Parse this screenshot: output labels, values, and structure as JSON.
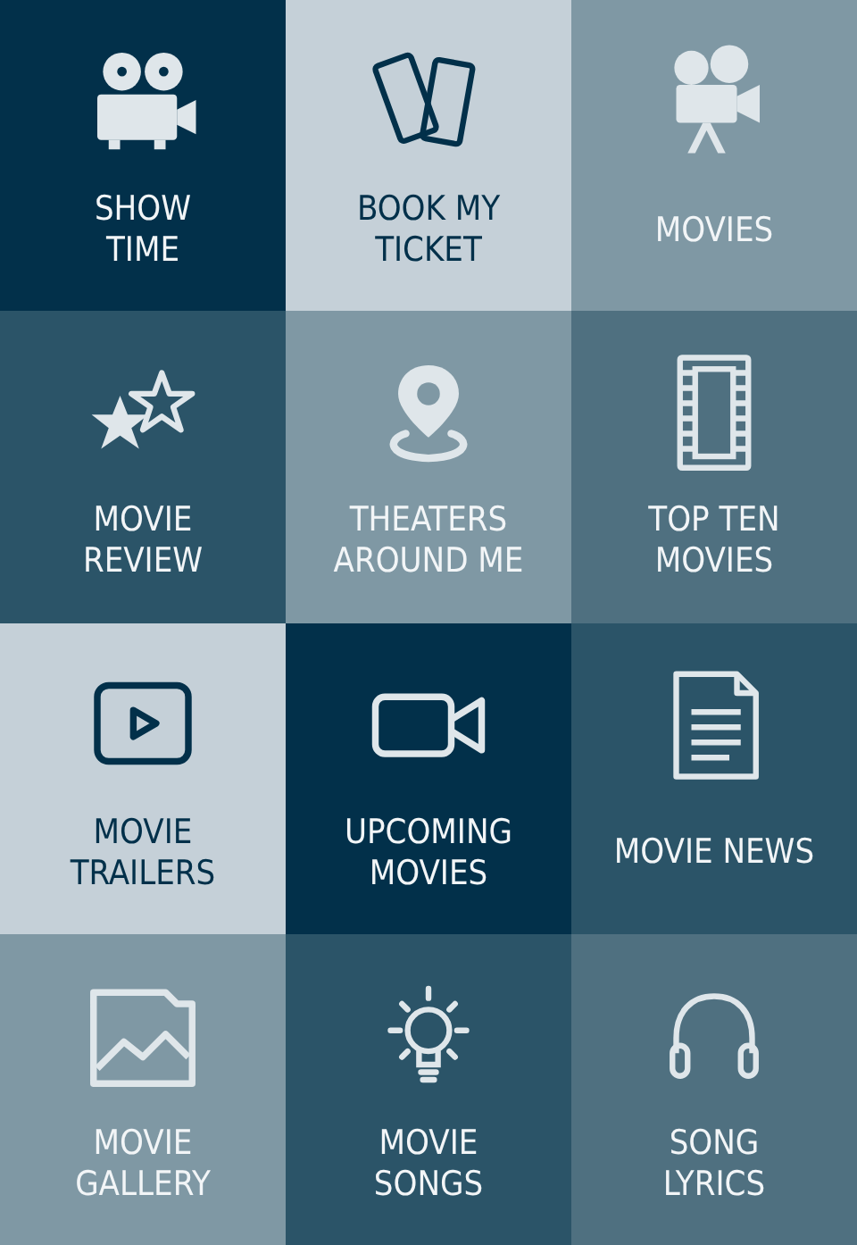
{
  "tiles": [
    {
      "lines": [
        "SHOW",
        "TIME"
      ],
      "color": "#02304a"
    },
    {
      "lines": [
        "BOOK MY",
        "TICKET"
      ],
      "color": "#c5d0d8"
    },
    {
      "lines": [
        "MOVIES"
      ],
      "color": "#7f98a4"
    },
    {
      "lines": [
        "MOVIE",
        "REVIEW"
      ],
      "color": "#2b5468"
    },
    {
      "lines": [
        "THEATERS",
        "AROUND ME"
      ],
      "color": "#7f98a4"
    },
    {
      "lines": [
        "TOP TEN",
        "MOVIES"
      ],
      "color": "#4f7080"
    },
    {
      "lines": [
        "MOVIE",
        "TRAILERS"
      ],
      "color": "#c5d0d8"
    },
    {
      "lines": [
        "UPCOMING",
        "MOVIES"
      ],
      "color": "#02304a"
    },
    {
      "lines": [
        "MOVIE NEWS"
      ],
      "color": "#2b5468"
    },
    {
      "lines": [
        "MOVIE",
        "GALLERY"
      ],
      "color": "#7f98a4"
    },
    {
      "lines": [
        "MOVIE",
        "SONGS"
      ],
      "color": "#2b5468"
    },
    {
      "lines": [
        "SONG",
        "LYRICS"
      ],
      "color": "#4f7080"
    }
  ]
}
